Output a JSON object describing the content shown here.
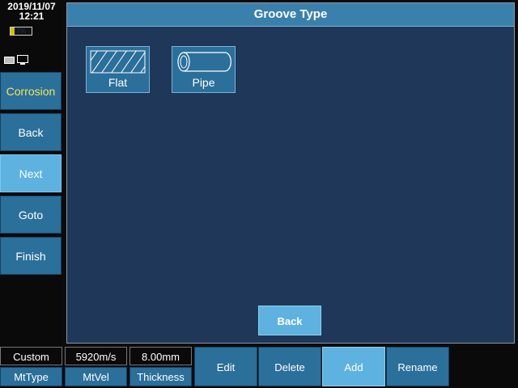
{
  "status": {
    "date": "2019/11/07",
    "time": "12:21",
    "battery_percent": 7,
    "battery_label": "7%",
    "icons": [
      "memory-card-icon",
      "monitor-icon"
    ]
  },
  "sidebar": {
    "items": [
      {
        "label": "Corrosion",
        "state": "highlighted"
      },
      {
        "label": "Back",
        "state": "normal"
      },
      {
        "label": "Next",
        "state": "active"
      },
      {
        "label": "Goto",
        "state": "normal"
      },
      {
        "label": "Finish",
        "state": "normal"
      }
    ]
  },
  "main": {
    "title": "Groove Type",
    "options": [
      {
        "label": "Flat",
        "icon": "flat-hatch-icon"
      },
      {
        "label": "Pipe",
        "icon": "pipe-icon"
      }
    ],
    "back_label": "Back"
  },
  "bottom": {
    "params": [
      {
        "value": "Custom",
        "name": "MtType"
      },
      {
        "value": "5920m/s",
        "name": "MtVel"
      },
      {
        "value": "8.00mm",
        "name": "Thickness"
      }
    ],
    "buttons": [
      {
        "label": "Edit",
        "state": "normal"
      },
      {
        "label": "Delete",
        "state": "normal"
      },
      {
        "label": "Add",
        "state": "active"
      },
      {
        "label": "Rename",
        "state": "normal"
      }
    ]
  },
  "colors": {
    "button_blue": "#2b6f9b",
    "active_blue": "#5db2e0",
    "panel_navy": "#1f3758",
    "highlight_yellow": "#f2e55a"
  }
}
